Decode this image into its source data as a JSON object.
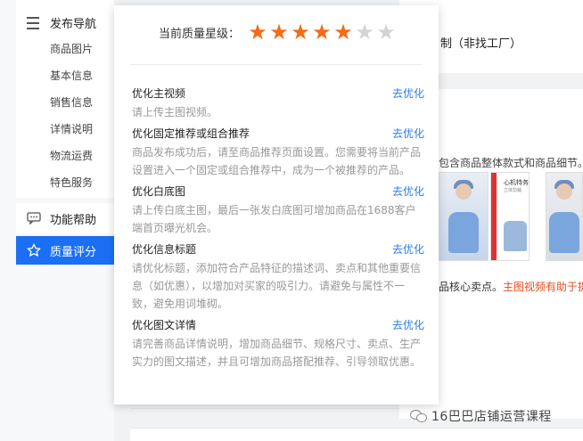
{
  "sidebar": {
    "nav_title": "发布导航",
    "nav_items": [
      {
        "label": "商品图片"
      },
      {
        "label": "基本信息"
      },
      {
        "label": "销售信息"
      },
      {
        "label": "详情说明"
      },
      {
        "label": "物流运费"
      },
      {
        "label": "特色服务"
      }
    ],
    "help_label": "功能帮助",
    "quality_label": "质量评分"
  },
  "background": {
    "top_text": "制（非找工厂）",
    "image_hint": "包含商品整体款式和商品细节。",
    "thumb_title": "心机特务套装",
    "thumb_sub": "立体剪裁",
    "bottom_text_plain": "品核心卖点。",
    "bottom_text_highlight": "主图视频有助于提"
  },
  "popup": {
    "rating_label": "当前质量星级：",
    "rating": 5,
    "rating_max": 7,
    "items": [
      {
        "title": "优化主视频",
        "desc": "请上传主图视频。",
        "action": "去优化"
      },
      {
        "title": "优化固定推荐或组合推荐",
        "desc": "商品发布成功后，请至商品推荐页面设置。您需要将当前产品设置进入一个固定或组合推荐中，成为一个被推荐的产品。",
        "action": "去优化"
      },
      {
        "title": "优化白底图",
        "desc": "请上传白底主图，最后一张发白底图可增加商品在1688客户端首页曝光机会。",
        "action": "去优化"
      },
      {
        "title": "优化信息标题",
        "desc": "请优化标题，添加符合产品特征的描述词、卖点和其他重要信息（如优惠），以增加对买家的吸引力。请避免与属性不一致，避免用词堆砌。",
        "action": "去优化"
      },
      {
        "title": "优化图文详情",
        "desc": "请完善商品详情说明，增加商品细节、规格尺寸、卖点、生产实力的图文描述，并且可增加商品搭配推荐、引导领取优惠。",
        "action": "去优化"
      }
    ]
  },
  "watermark": {
    "label": "16巴巴店铺运营课程"
  },
  "colors": {
    "accent": "#1b6ff5",
    "star_on": "#f56a17",
    "star_off": "#d3d4d6",
    "link": "#2b7de9",
    "highlight": "#e84c1e"
  }
}
